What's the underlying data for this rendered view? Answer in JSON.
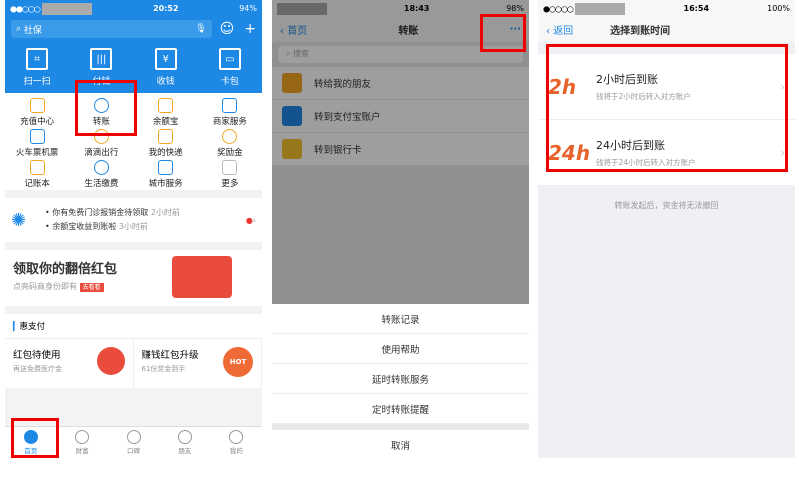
{
  "p1": {
    "carrier": "●●○○○",
    "time": "20:52",
    "battery": "94%",
    "search": "社保",
    "tiles": [
      "扫一扫",
      "付钱",
      "收钱",
      "卡包"
    ],
    "grid": [
      "充值中心",
      "转账",
      "余额宝",
      "商家服务",
      "火车票机票",
      "滴滴出行",
      "我的快递",
      "奖励金",
      "记账本",
      "生活缴费",
      "城市服务",
      "更多"
    ],
    "notice1": "你有免费门诊报销金待领取",
    "notice1_time": "2小时前",
    "notice2": "余额宝收益到账啦",
    "notice2_time": "3小时前",
    "banner_title": "领取你的翻倍红包",
    "banner_sub": "点亮码商身份即有",
    "banner_btn": "去看看",
    "hui": "惠支付",
    "card1_title": "红包待使用",
    "card1_sub": "再送免费医疗金",
    "card2_title": "赚钱红包升级",
    "card2_sub": "61份赏金到手",
    "card2_badge": "HOT",
    "tabs": [
      "首页",
      "财富",
      "口碑",
      "朋友",
      "我的"
    ]
  },
  "p2": {
    "carrier": "",
    "time": "18:43",
    "battery": "98%",
    "back": "首页",
    "title": "转账",
    "more": "···",
    "search_ph": "搜索",
    "list": [
      "转给我的朋友",
      "转到支付宝账户",
      "转到银行卡"
    ],
    "sheet": [
      "转账记录",
      "使用帮助",
      "延时转账服务",
      "定时转账提醒"
    ],
    "cancel": "取消"
  },
  "p3": {
    "carrier": "●○○○○",
    "time": "16:54",
    "battery": "100%",
    "back": "返回",
    "title": "选择到账时间",
    "opt1_icon": "2h",
    "opt1_title": "2小时后到账",
    "opt1_sub": "钱将于2小时后转入对方账户",
    "opt2_icon": "24h",
    "opt2_title": "24小时后到账",
    "opt2_sub": "钱将于24小时后转入对方账户",
    "tip": "转账发起后，资金将无法撤回"
  }
}
